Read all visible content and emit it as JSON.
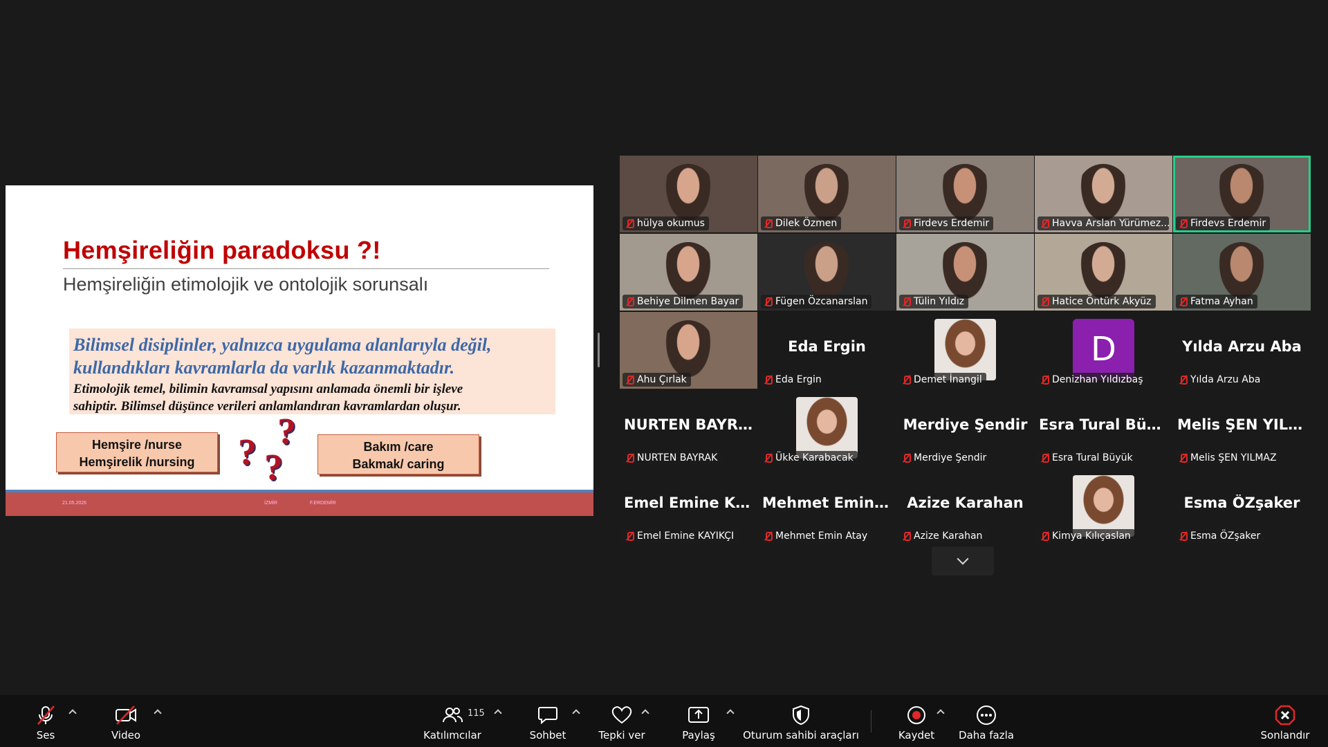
{
  "slide": {
    "title": "Hemşireliğin paradoksu ?!",
    "subtitle": "Hemşireliğin etimolojik ve ontolojik sorunsalı",
    "quote_main_1": "Bilimsel disiplinler, yalnızca uygulama alanlarıyla değil,",
    "quote_main_2": "kullandıkları kavramlarla da varlık kazanmaktadır.",
    "quote_sub_1": "Etimolojik temel, bilimin kavramsal yapısını anlamada önemli bir işleve",
    "quote_sub_2": "sahiptir. Bilimsel düşünce verileri anlamlandıran kavramlardan oluşur.",
    "term_left_1": "Hemşire /nurse",
    "term_left_2": "Hemşirelik /nursing",
    "term_right_1": "Bakım /care",
    "term_right_2": "Bakmak/ caring",
    "qmark": "?",
    "footer_date": "21.05.2026",
    "footer_city": "İZMİR",
    "footer_author": "F.ERDEMİR",
    "colors": {
      "title": "#c00000",
      "quote": "#3d68a8",
      "footer": "#c0504d",
      "footer_line": "#4f81bd"
    }
  },
  "gallery": {
    "tiles": [
      {
        "name": "hülya okumus",
        "type": "video"
      },
      {
        "name": "Dilek Özmen",
        "type": "video"
      },
      {
        "name": "Firdevs Erdemir",
        "type": "video"
      },
      {
        "name": "Havva Arslan Yürümez...",
        "type": "video"
      },
      {
        "name": "Firdevs Erdemir",
        "type": "video",
        "active": true
      },
      {
        "name": "Behiye Dilmen Bayar",
        "type": "video"
      },
      {
        "name": "Fügen Özcanarslan",
        "type": "video"
      },
      {
        "name": "Tülin Yıldız",
        "type": "video"
      },
      {
        "name": "Hatice Öntürk Akyüz",
        "type": "video"
      },
      {
        "name": "Fatma Ayhan",
        "type": "video"
      },
      {
        "name": "Ahu Çırlak",
        "type": "video"
      },
      {
        "name": "Eda Ergin",
        "type": "name",
        "display": "Eda Ergin"
      },
      {
        "name": "Demet İnangil",
        "type": "photo"
      },
      {
        "name": "Denizhan Yıldızbaş",
        "type": "letter",
        "letter": "D"
      },
      {
        "name": "Yılda Arzu Aba",
        "type": "name",
        "display": "Yılda Arzu Aba"
      },
      {
        "name": "NURTEN BAYRAK",
        "type": "name",
        "display": "NURTEN BAYRAK"
      },
      {
        "name": "Ükke Karabacak",
        "type": "photo"
      },
      {
        "name": "Merdiye Şendir",
        "type": "name",
        "display": "Merdiye Şendir"
      },
      {
        "name": "Esra Tural Büyük",
        "type": "name",
        "display": "Esra Tural Büyük"
      },
      {
        "name": "Melis ŞEN YILMAZ",
        "type": "name",
        "display": "Melis ŞEN YILM..."
      },
      {
        "name": "Emel Emine KAYIKÇI",
        "type": "name",
        "display": "Emel Emine KAY..."
      },
      {
        "name": "Mehmet Emin Atay",
        "type": "name",
        "display": "Mehmet Emin A..."
      },
      {
        "name": "Azize Karahan",
        "type": "name",
        "display": "Azize Karahan"
      },
      {
        "name": "Kimya Kılıçaslan",
        "type": "photo"
      },
      {
        "name": "Esma ÖZşaker",
        "type": "name",
        "display": "Esma ÖZşaker"
      }
    ]
  },
  "toolbar": {
    "audio_label": "Ses",
    "video_label": "Video",
    "participants_label": "Katılımcılar",
    "participants_count": "115",
    "chat_label": "Sohbet",
    "reactions_label": "Tepki ver",
    "share_label": "Paylaş",
    "host_tools_label": "Oturum sahibi araçları",
    "record_label": "Kaydet",
    "more_label": "Daha fazla",
    "end_label": "Sonlandır",
    "colors": {
      "active_border": "#23d18b",
      "muted_red": "#e02828",
      "record": "#e02828",
      "end": "#e02828"
    }
  }
}
